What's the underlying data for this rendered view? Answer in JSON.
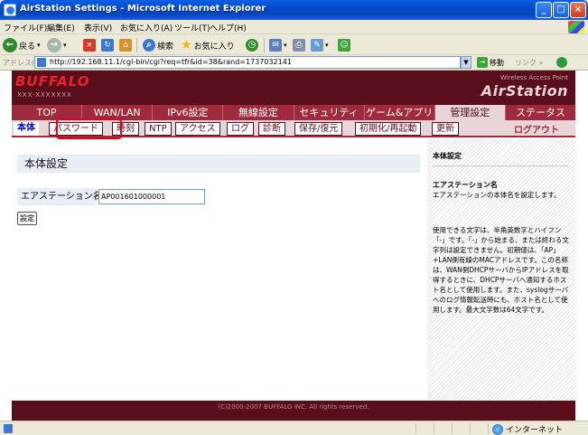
{
  "window": {
    "title": "AirStation Settings - Microsoft Internet Explorer"
  },
  "menubar": [
    "ファイル(F)",
    "編集(E)",
    "表示(V)",
    "お気に入り(A)",
    "ツール(T)",
    "ヘルプ(H)"
  ],
  "toolbar": {
    "back_label": "戻る",
    "search_label": "検索",
    "favorites_label": "お気に入り"
  },
  "address": {
    "label": "アドレス(D)",
    "url": "http://192.168.11.1/cgi-bin/cgi?req=tfr&id=38&rand=1737032141",
    "go_label": "移動",
    "links_label": "リンク »"
  },
  "header": {
    "logo": "BUFFALO",
    "logo_sub": "XXX-XXXXXXX",
    "product_small": "Wireless Access Point",
    "product_big": "AirStation"
  },
  "tabs": [
    "TOP",
    "WAN/LAN",
    "IPv6設定",
    "無線設定",
    "セキュリティ",
    "ゲーム&アプリ",
    "管理設定",
    "ステータス"
  ],
  "subnav": {
    "items": [
      "本体",
      "パスワード",
      "時刻",
      "NTP",
      "アクセス",
      "ログ",
      "診断",
      "保存/復元",
      "初期化/再起動",
      "更新"
    ],
    "logout": "ログアウト"
  },
  "main": {
    "section_title": "本体設定",
    "name_label": "エアステーション名",
    "name_value": "AP001601000001",
    "set_button": "設定"
  },
  "help": {
    "title": "本体設定",
    "subtitle": "エアステーション名",
    "desc": "エアステーションの本体名を設定します。",
    "body": "使用できる文字は、半角英数字とハイフン「-」です。「-」から始まる、または終わる文字列は設定できません。初期値は、「AP」+LAN側有線のMACアドレスです。この名称は、WAN側DHCPサーバからIPアドレスを取得するときに、DHCPサーバへ通知するホスト名として使用します。また、syslogサーバへのログ情報転送時にも、ホスト名として使用します。最大文字数は64文字です。"
  },
  "footer": "(C)2000-2007 BUFFALO INC. All rights reserved.",
  "status": {
    "zone": "インターネット"
  },
  "colors": {
    "header": "#5a0d1a",
    "tab_bar": "#9e2a3b",
    "tab_active": "#e8d5d8",
    "highlight": "#e0001a"
  }
}
